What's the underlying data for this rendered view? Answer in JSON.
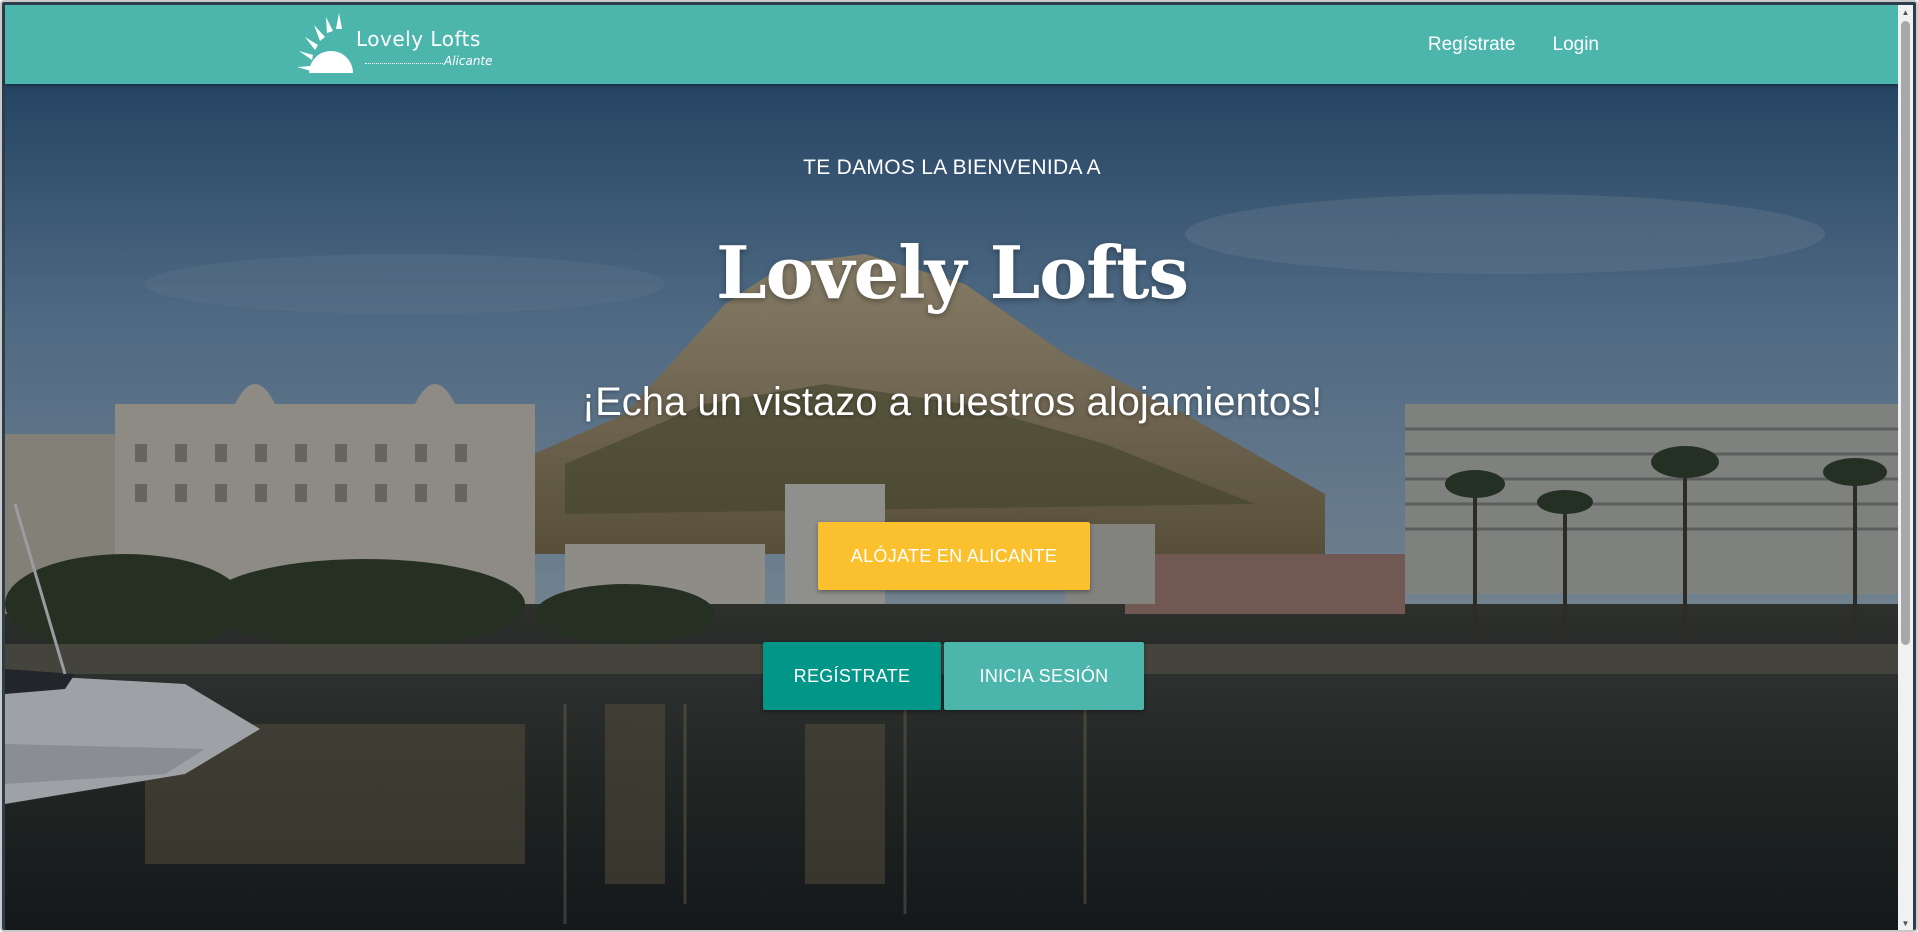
{
  "navbar": {
    "brand_name": "Lovely Lofts",
    "brand_sub": "Alicante",
    "links": {
      "register": "Regístrate",
      "login": "Login"
    }
  },
  "hero": {
    "welcome": "TE DAMOS LA BIENVENIDA A",
    "title": "Lovely Lofts",
    "subtitle": "¡Echa un vistazo a nuestros alojamientos!",
    "stay_button": "ALÓJATE EN ALICANTE",
    "register_button": "REGÍSTRATE",
    "login_button": "INICIA SESIÓN"
  },
  "scrollbar": {
    "up_icon": "chevron-up-icon",
    "down_icon": "chevron-down-icon"
  },
  "colors": {
    "navbar": "#4db6ac",
    "stay_button": "#fbc02d",
    "register_button": "#009688",
    "login_button": "#4db6ac"
  }
}
